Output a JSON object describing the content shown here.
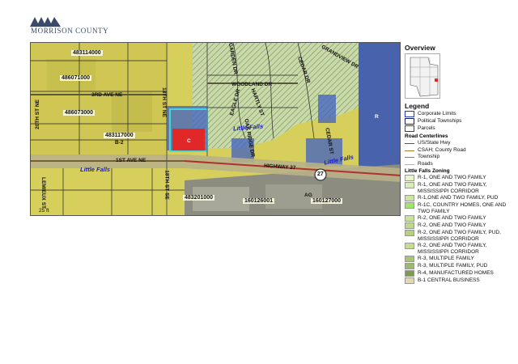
{
  "header": {
    "brand": "MORRISON COUNTY"
  },
  "map": {
    "parcels": [
      "483114000",
      "486071000",
      "486073000",
      "483117000",
      "483201000",
      "160126001",
      "160127000"
    ],
    "roads": [
      "WOODLAND DR",
      "3RD AVE NE",
      "1ST AVE NE",
      "HIGHWAY 27",
      "18TH ST NE",
      "18TH ST SE",
      "LEMIEUX ST",
      "20TH ST NE",
      "GARDEN DR",
      "EAGLE DR",
      "HARTLY ST",
      "GRANDVIEW DR",
      "CEDAR DR",
      "OAK RIDGE DR",
      "CEDAR ST"
    ],
    "cities": [
      "Little Falls",
      "Little Falls",
      "Little Falls"
    ],
    "zones": [
      "C",
      "B-2",
      "AG",
      "R",
      "25 ft"
    ],
    "highway_shield": "27"
  },
  "legend": {
    "overview_title": "Overview",
    "legend_title": "Legend",
    "items": [
      {
        "label": "Corporate Limits",
        "kind": "box",
        "fill": "#ffffff",
        "stroke": "#1f3fb0"
      },
      {
        "label": "Political Townships",
        "kind": "box",
        "fill": "#ffffff",
        "stroke": "#1b1b6e"
      },
      {
        "label": "Parcels",
        "kind": "box",
        "fill": "#ffffff",
        "stroke": "#444444"
      }
    ],
    "roads_title": "Road Centerlines",
    "roads": [
      {
        "label": "US/State Hwy",
        "color": "#b03030"
      },
      {
        "label": "CSAH; County Road",
        "color": "#b07b2b"
      },
      {
        "label": "Township",
        "color": "#7a7a7a"
      },
      {
        "label": "Roads",
        "color": "#b0b0b0"
      }
    ],
    "zoning_title": "Little Falls Zoning",
    "zoning": [
      {
        "label": "R-1, ONE AND TWO FAMILY",
        "color": "#e8f5c8"
      },
      {
        "label": "R-1, ONE AND TWO FAMILY, MISSISSIPPI CORRIDOR",
        "color": "#d8eeb0"
      },
      {
        "label": "R-1,ONE AND TWO FAMILY, PUD",
        "color": "#cbe6a3"
      },
      {
        "label": "R-1C, COUNTRY HOMES, ONE AND TWO FAMILY",
        "color": "#9be86a"
      },
      {
        "label": "R-2, ONE AND TWO FAMILY",
        "color": "#c9e29c"
      },
      {
        "label": "R-2, ONE AND TWO FAMILY",
        "color": "#bcd98b"
      },
      {
        "label": "R-2, ONE AND TWO FAMILY, PUD, MISSISSIPPI CORRIDOR",
        "color": "#b3d17f"
      },
      {
        "label": "R-2, ONE AND TWO FAMILY, MISSISSIPPI CORRIDOR",
        "color": "#c6dd90"
      },
      {
        "label": "R-3, MULTIPLE FAMILY",
        "color": "#a9c47a"
      },
      {
        "label": "R-3, MULTIPLE FAMILY, PUD",
        "color": "#9db86f"
      },
      {
        "label": "R-4, MANUFACTURED HOMES",
        "color": "#7e9a55"
      },
      {
        "label": "B-1 CENTRAL BUSINESS",
        "color": "#e2d8b4"
      }
    ]
  }
}
